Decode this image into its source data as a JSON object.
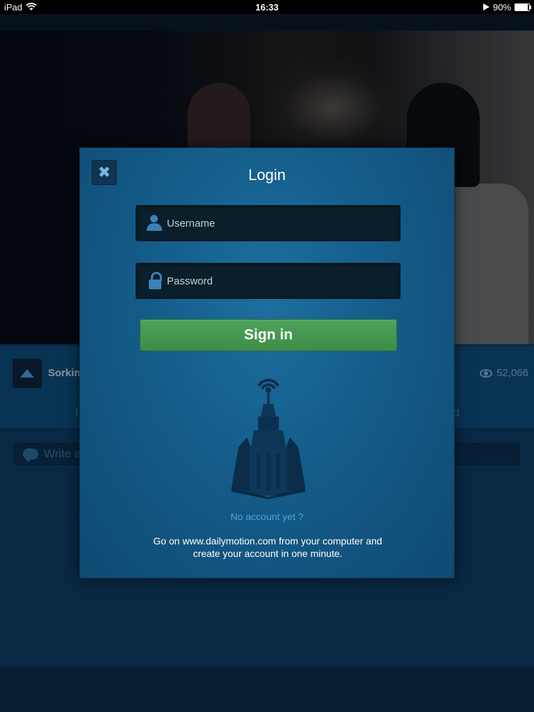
{
  "status_bar": {
    "device": "iPad",
    "time": "16:33",
    "battery": "90%",
    "battery_level": 0.9
  },
  "video_info": {
    "channel": "Sorkini",
    "views": "52,066",
    "tab_left": "I",
    "tab_right": "d"
  },
  "comment": {
    "placeholder": "Write a"
  },
  "login_modal": {
    "title": "Login",
    "close_icon": "close-icon",
    "username_placeholder": "Username",
    "password_placeholder": "Password",
    "signin_label": "Sign in",
    "no_account": "No account yet ?",
    "info_line1": "Go on www.dailymotion.com from your computer and",
    "info_line2": "create your account in one minute.",
    "signin_color": "#46985",
    "link_color": "#4aa7e0"
  }
}
